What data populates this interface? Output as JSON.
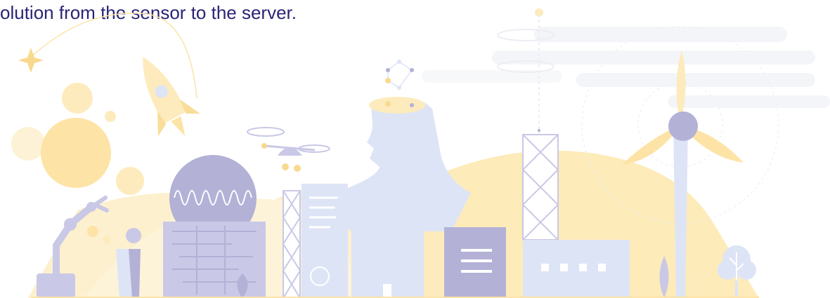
{
  "headline": {
    "text": "olution from the sensor to the server."
  },
  "illustration": {
    "colors": {
      "navy": "#2a2475",
      "yellow": "#fdeab9",
      "yellow_strong": "#f9dd98",
      "lavender": "#c9c8e6",
      "lavender_dark": "#b3b1d6",
      "blue_light": "#dde4f6",
      "gray_light": "#f5f6f8"
    },
    "elements": [
      "star-icon",
      "rocket-icon",
      "planet-icon",
      "robot-arm-icon",
      "person-icon",
      "radar-dome-icon",
      "wave-icon",
      "server-block-icon",
      "lattice-tower-icon",
      "drone-icon",
      "document-icon",
      "human-head-icon",
      "network-nodes-icon",
      "antenna-tower-icon",
      "building-icon",
      "wind-turbine-icon",
      "tree-icon",
      "leaf-icon",
      "cloud-icon",
      "hill-icon"
    ]
  }
}
